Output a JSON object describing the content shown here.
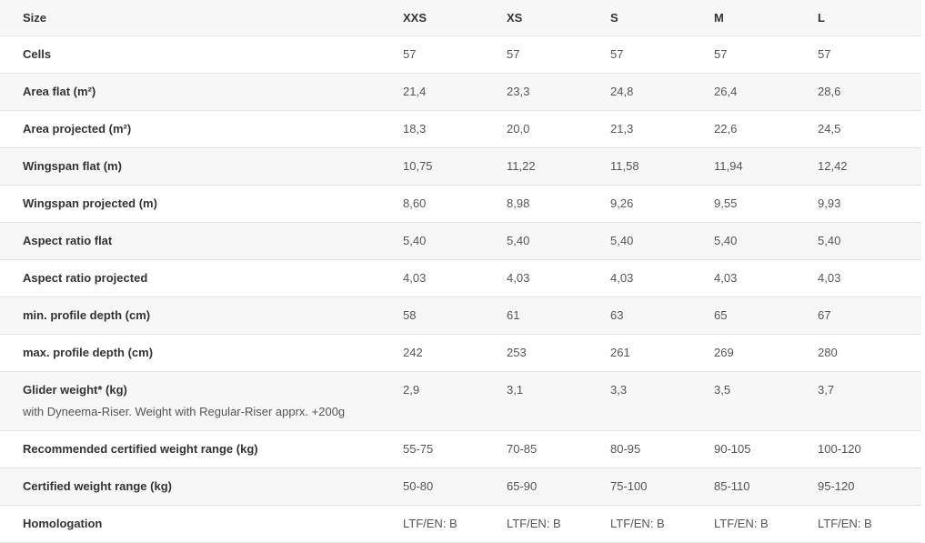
{
  "table": {
    "columns": [
      "Size",
      "XXS",
      "XS",
      "S",
      "M",
      "L"
    ],
    "rows": [
      {
        "label": "Cells",
        "note": "",
        "values": [
          "57",
          "57",
          "57",
          "57",
          "57"
        ]
      },
      {
        "label": "Area flat (m²)",
        "note": "",
        "values": [
          "21,4",
          "23,3",
          "24,8",
          "26,4",
          "28,6"
        ]
      },
      {
        "label": "Area projected (m²)",
        "note": "",
        "values": [
          "18,3",
          "20,0",
          "21,3",
          "22,6",
          "24,5"
        ]
      },
      {
        "label": "Wingspan flat (m)",
        "note": "",
        "values": [
          "10,75",
          "11,22",
          "11,58",
          "11,94",
          "12,42"
        ]
      },
      {
        "label": "Wingspan projected (m)",
        "note": "",
        "values": [
          "8,60",
          "8,98",
          "9,26",
          "9,55",
          "9,93"
        ]
      },
      {
        "label": "Aspect ratio flat",
        "note": "",
        "values": [
          "5,40",
          "5,40",
          "5,40",
          "5,40",
          "5,40"
        ]
      },
      {
        "label": "Aspect ratio projected",
        "note": "",
        "values": [
          "4,03",
          "4,03",
          "4,03",
          "4,03",
          "4,03"
        ]
      },
      {
        "label": "min. profile depth (cm)",
        "note": "",
        "values": [
          "58",
          "61",
          "63",
          "65",
          "67"
        ]
      },
      {
        "label": "max. profile depth (cm)",
        "note": "",
        "values": [
          "242",
          "253",
          "261",
          "269",
          "280"
        ]
      },
      {
        "label": "Glider weight* (kg)",
        "note": "with Dyneema-Riser. Weight with Regular-Riser apprx. +200g",
        "values": [
          "2,9",
          "3,1",
          "3,3",
          "3,5",
          "3,7"
        ]
      },
      {
        "label": "Recommended certified weight range (kg)",
        "note": "",
        "values": [
          "55-75",
          "70-85",
          "80-95",
          "90-105",
          "100-120"
        ]
      },
      {
        "label": "Certified weight range (kg)",
        "note": "",
        "values": [
          "50-80",
          "65-90",
          "75-100",
          "85-110",
          "95-120"
        ]
      },
      {
        "label": "Homologation",
        "note": "",
        "values": [
          "LTF/EN: B",
          "LTF/EN: B",
          "LTF/EN: B",
          "LTF/EN: B",
          "LTF/EN: B"
        ]
      }
    ]
  },
  "colors": {
    "stripe": "#f7f7f7",
    "base": "#ffffff",
    "divider": "#e4e4e4",
    "label_text": "#333333",
    "value_text": "#555555"
  }
}
